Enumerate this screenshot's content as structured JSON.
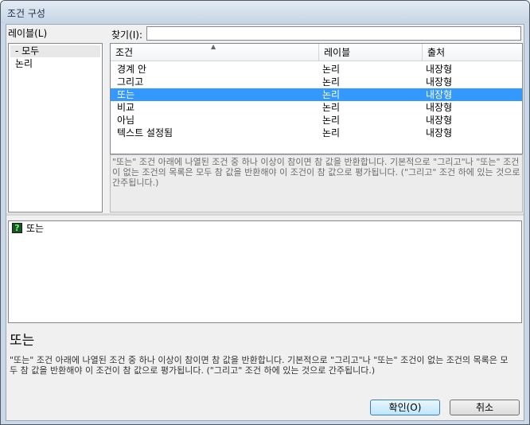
{
  "window": {
    "title": "조건 구성"
  },
  "labels_panel": {
    "header": "레이블(L)",
    "items": [
      "- 모두",
      "논리"
    ]
  },
  "search": {
    "label": "찾기(I):",
    "value": ""
  },
  "table": {
    "columns": [
      "조건",
      "레이블",
      "출처"
    ],
    "rows": [
      [
        "경계 안",
        "논리",
        "내장형"
      ],
      [
        "그리고",
        "논리",
        "내장형"
      ],
      [
        "또는",
        "논리",
        "내장형"
      ],
      [
        "비교",
        "논리",
        "내장형"
      ],
      [
        "아님",
        "논리",
        "내장형"
      ],
      [
        "텍스트 설정됨",
        "논리",
        "내장형"
      ]
    ],
    "selected_index": 2
  },
  "selected_description": "\"또는\" 조건 아래에 나열된 조건 중 하나 이상이 참이면 참 값을 반환합니다. 기본적으로 \"그리고\"나 \"또는\" 조건이 없는 조건의 목록은 모두 참 값을 반환해야 이 조건이 참 값으로 평가됩니다. (\"그리고\" 조건 하에 있는 것으로 간주됩니다.)",
  "tree": {
    "item_label": "또는",
    "icon": "question-mark-icon"
  },
  "detail": {
    "title": "또는",
    "description": "\"또는\" 조건 아래에 나열된 조건 중 하나 이상이 참이면 참 값을 반환합니다. 기본적으로 \"그리고\"나 \"또는\" 조건이 없는 조건의 목록은 모두 참 값을 반환해야 이 조건이 참 값으로 평가됩니다. (\"그리고\" 조건 하에 있는 것으로 간주됩니다.)"
  },
  "buttons": {
    "ok": "확인(O)",
    "cancel": "취소"
  },
  "colors": {
    "selection": "#3399ff",
    "title_bar": "#c9d7e6"
  }
}
